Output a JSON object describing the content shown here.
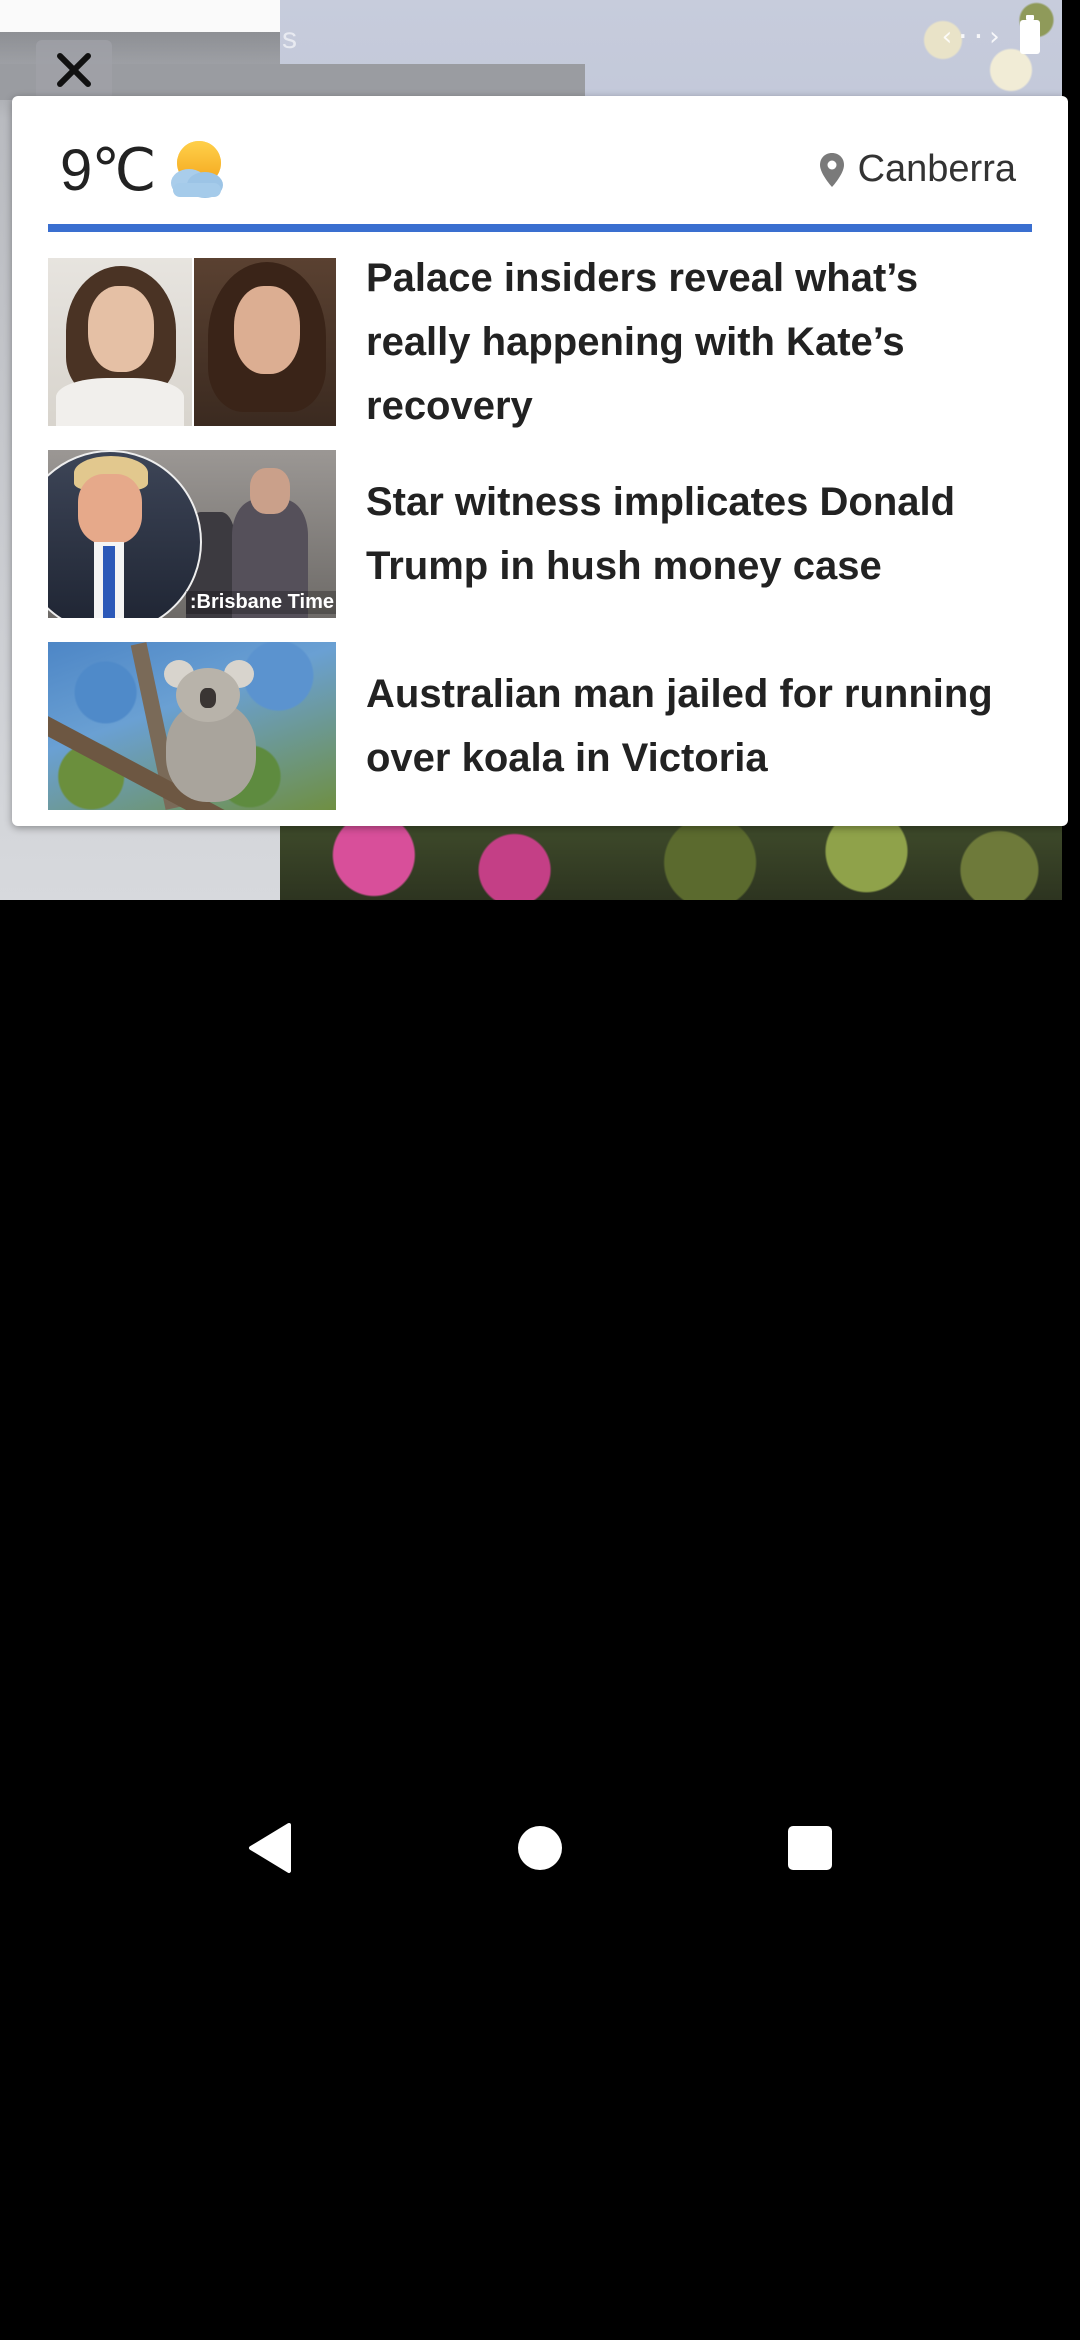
{
  "background": {
    "partial_label": "s"
  },
  "close_button": {
    "icon": "close-icon"
  },
  "widget": {
    "weather": {
      "temperature": "9℃",
      "condition_icon": "partly-cloudy-icon"
    },
    "location": {
      "icon": "location-pin-icon",
      "city": "Canberra"
    },
    "accent_color": "#3a6fd0",
    "news": [
      {
        "headline": "Palace insiders reveal what’s really happening with Kate’s recovery",
        "thumbnail": "kate-photo"
      },
      {
        "headline": "Star witness implicates Donald Trump in hush money case",
        "thumbnail": "trump-photo",
        "thumbnail_watermark": ":Brisbane Time"
      },
      {
        "headline": "Australian man jailed for running over koala in Victoria",
        "thumbnail": "koala-photo"
      }
    ]
  },
  "nav_bar": {
    "back_icon": "back-triangle-icon",
    "home_icon": "home-circle-icon",
    "recents_icon": "recents-square-icon"
  }
}
